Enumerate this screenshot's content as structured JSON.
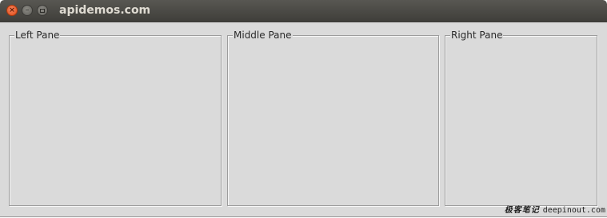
{
  "window": {
    "title": "apidemos.com",
    "controls": {
      "close_glyph": "×",
      "minimize_glyph": "–"
    }
  },
  "panes": [
    {
      "label": "Left Pane"
    },
    {
      "label": "Middle Pane"
    },
    {
      "label": "Right Pane"
    }
  ],
  "watermark": {
    "chinese": "极客笔记",
    "site": "deepinout.com"
  },
  "colors": {
    "titlebar": "#45443f",
    "window_bg": "#dadada",
    "close_button": "#e95420",
    "title_text": "#dfdbd2"
  }
}
